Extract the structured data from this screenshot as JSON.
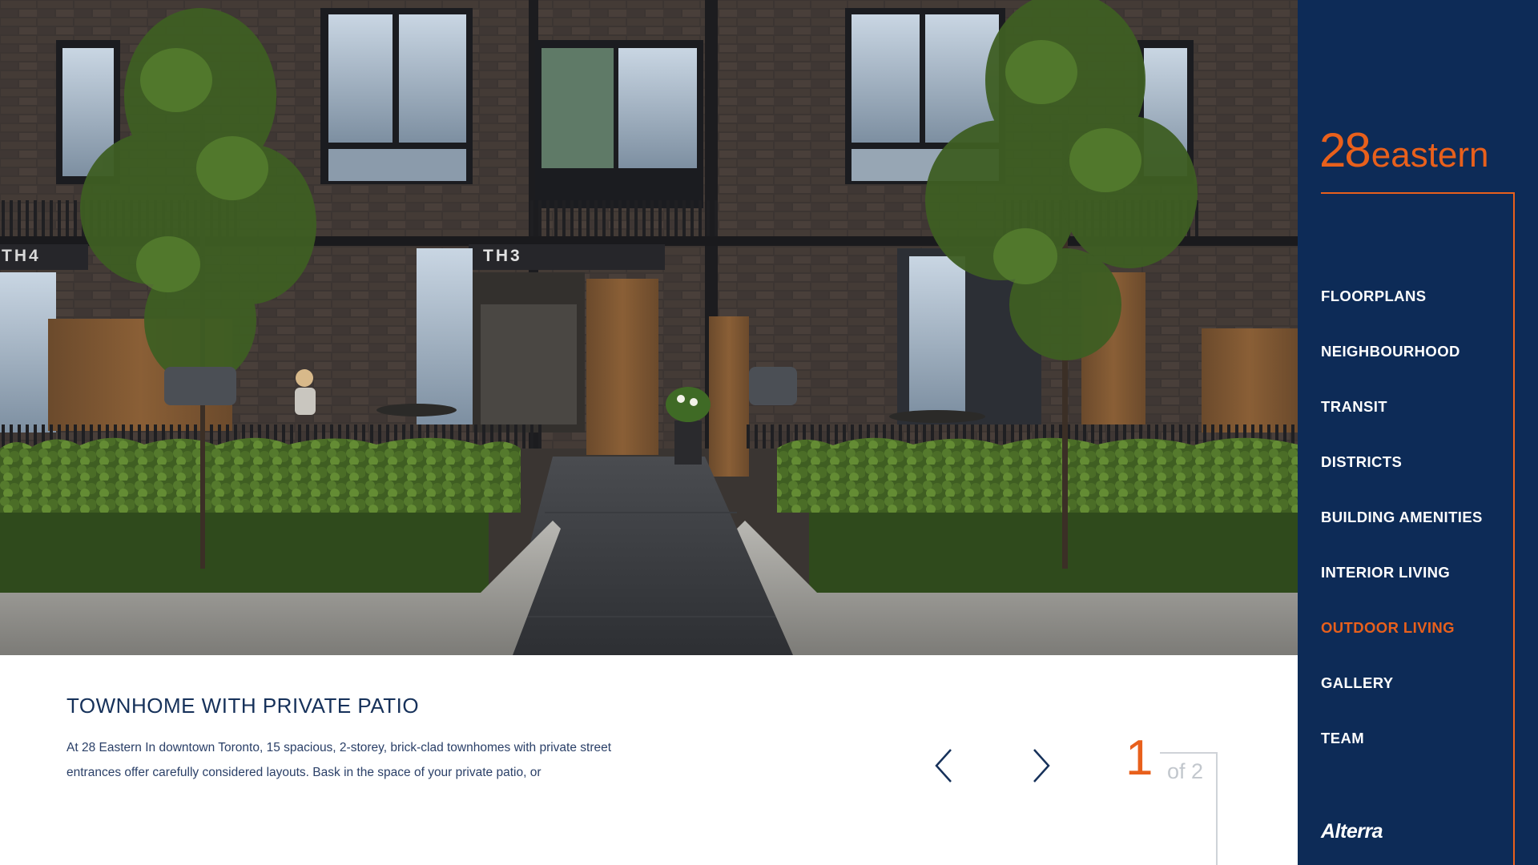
{
  "slide": {
    "title": "TOWNHOME WITH PRIVATE PATIO",
    "description": "At 28 Eastern In downtown Toronto, 15 spacious, 2-storey, brick-clad townhomes with private street entrances offer carefully considered layouts. Bask in the space of your private patio, or",
    "unit_signs": [
      "TH4",
      "TH3"
    ]
  },
  "pager": {
    "current": "1",
    "total_label": "of 2",
    "prev_icon": "chevron-left-icon",
    "next_icon": "chevron-right-icon"
  },
  "sidebar": {
    "logo_number": "28",
    "logo_word": "eastern",
    "nav": [
      {
        "label": "FLOORPLANS",
        "active": false
      },
      {
        "label": "NEIGHBOURHOOD",
        "active": false
      },
      {
        "label": "TRANSIT",
        "active": false
      },
      {
        "label": "DISTRICTS",
        "active": false
      },
      {
        "label": "BUILDING AMENITIES",
        "active": false
      },
      {
        "label": "INTERIOR LIVING",
        "active": false
      },
      {
        "label": "OUTDOOR LIVING",
        "active": true
      },
      {
        "label": "GALLERY",
        "active": false
      },
      {
        "label": "TEAM",
        "active": false
      }
    ],
    "brand": "Alterra"
  },
  "colors": {
    "sidebar_bg": "#0d2b57",
    "accent": "#e8601c",
    "title_text": "#16315a",
    "body_text": "#2b4068",
    "counter_muted": "#c2c7cd"
  }
}
